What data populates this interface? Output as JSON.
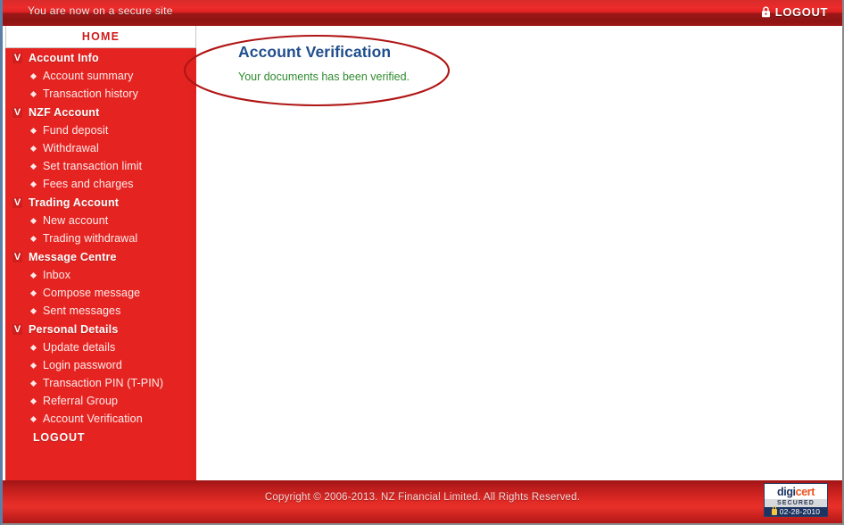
{
  "header": {
    "secure_notice": "You are now on a secure site",
    "logout_label": "LOGOUT",
    "logout_icon": "padlock-icon",
    "bar_color": "#e32222"
  },
  "tab": {
    "home_label": "HOME"
  },
  "sidebar": {
    "accent_color": "#e52421",
    "groups": [
      {
        "marker": "V",
        "label": "Account Info",
        "items": [
          "Account summary",
          "Transaction history"
        ]
      },
      {
        "marker": "V",
        "label": "NZF Account",
        "items": [
          "Fund deposit",
          "Withdrawal",
          "Set transaction limit",
          "Fees and charges"
        ]
      },
      {
        "marker": "V",
        "label": "Trading Account",
        "items": [
          "New account",
          "Trading withdrawal"
        ]
      },
      {
        "marker": "V",
        "label": "Message Centre",
        "items": [
          "Inbox",
          "Compose message",
          "Sent messages"
        ]
      },
      {
        "marker": "V",
        "label": "Personal Details",
        "items": [
          "Update details",
          "Login password",
          "Transaction PIN (T-PIN)",
          "Referral Group",
          "Account Verification"
        ]
      }
    ],
    "logout_label": "LOGOUT"
  },
  "main": {
    "title": "Account Verification",
    "title_color": "#1f4e8c",
    "message": "Your documents has been verified.",
    "message_color": "#2f8a2f"
  },
  "annotation": {
    "shape": "ellipse",
    "color": "#b01515"
  },
  "footer": {
    "copyright": "Copyright © 2006-2013. NZ Financial Limited. All Rights Reserved.",
    "badge": {
      "brand_first": "digi",
      "brand_second": "cert",
      "secured_label": "SECURED",
      "date": "02-28-2010",
      "lock_icon": "padlock-icon"
    }
  }
}
